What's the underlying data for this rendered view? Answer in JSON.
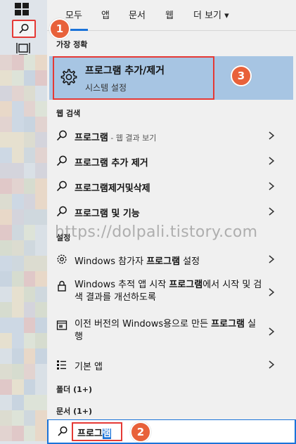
{
  "tabs": [
    {
      "label": "모두"
    },
    {
      "label": "앱"
    },
    {
      "label": "문서"
    },
    {
      "label": "웹"
    },
    {
      "label": "더 보기 ▾"
    }
  ],
  "best_match": {
    "heading": "가장 정확",
    "title": "프로그램 추가/제거",
    "subtitle": "시스템 설정"
  },
  "web_search": {
    "heading": "웹 검색",
    "items": [
      {
        "bold": "프로그램",
        "rest": " - 웹 결과 보기"
      },
      {
        "bold": "프로그램 추가 제거",
        "rest": ""
      },
      {
        "bold": "프로그램제거및삭제",
        "rest": ""
      },
      {
        "bold": "프로그램 및 기능",
        "rest": ""
      }
    ]
  },
  "settings": {
    "heading": "설정",
    "items": [
      {
        "pre": "Windows 참가자 ",
        "bold": "프로그램",
        "post": " 설정"
      },
      {
        "pre": "Windows 추적 앱 시작 ",
        "bold": "프로그램",
        "post": "에서 시작 및 검색 결과를 개선하도록"
      },
      {
        "pre": "이전 버전의 Windows용으로 만든 ",
        "bold": "프로그램",
        "post": " 실행"
      },
      {
        "pre": "기본 앱",
        "bold": "",
        "post": ""
      }
    ]
  },
  "folders": {
    "heading": "폴더 (1+)"
  },
  "documents": {
    "heading": "문서 (1+)"
  },
  "search": {
    "typed": "프로그",
    "selected": "램"
  },
  "badges": [
    "1",
    "2",
    "3"
  ],
  "watermark": "https://dolpali.tistory.com",
  "colors": {
    "accent": "#1a73d9",
    "highlight": "#e53935",
    "badge": "#e8613a",
    "selected_row": "#a7c5e3"
  }
}
